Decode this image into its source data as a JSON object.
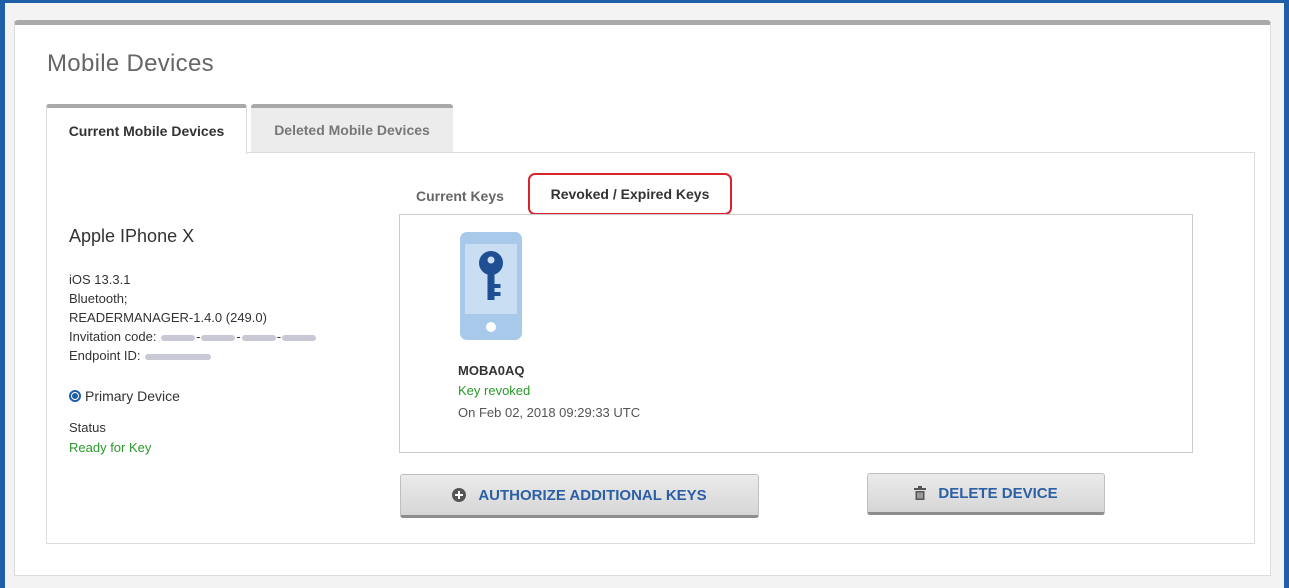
{
  "page": {
    "title": "Mobile Devices"
  },
  "tabs": [
    {
      "label": "Current Mobile Devices",
      "active": true
    },
    {
      "label": "Deleted Mobile Devices",
      "active": false
    }
  ],
  "device": {
    "name": "Apple IPhone X",
    "os": "iOS 13.3.1",
    "connectivity": "Bluetooth;",
    "app_version": "READERMANAGER-1.4.0 (249.0)",
    "invitation_label": "Invitation code:",
    "endpoint_label": "Endpoint ID:",
    "primary_label": "Primary Device",
    "status_label": "Status",
    "status_value": "Ready for Key"
  },
  "key_tabs": [
    {
      "label": "Current Keys",
      "active": false
    },
    {
      "label": "Revoked / Expired Keys",
      "active": true
    }
  ],
  "key": {
    "id": "MOBA0AQ",
    "status": "Key revoked",
    "date": "On Feb 02, 2018 09:29:33 UTC",
    "icon": "phone-key-icon"
  },
  "actions": {
    "authorize_label": "AUTHORIZE ADDITIONAL KEYS",
    "delete_label": "DELETE DEVICE"
  },
  "colors": {
    "accent": "#1f5fa8",
    "button_text": "#2b5fa6",
    "success": "#2a9a2a",
    "highlight": "#d9232e"
  }
}
